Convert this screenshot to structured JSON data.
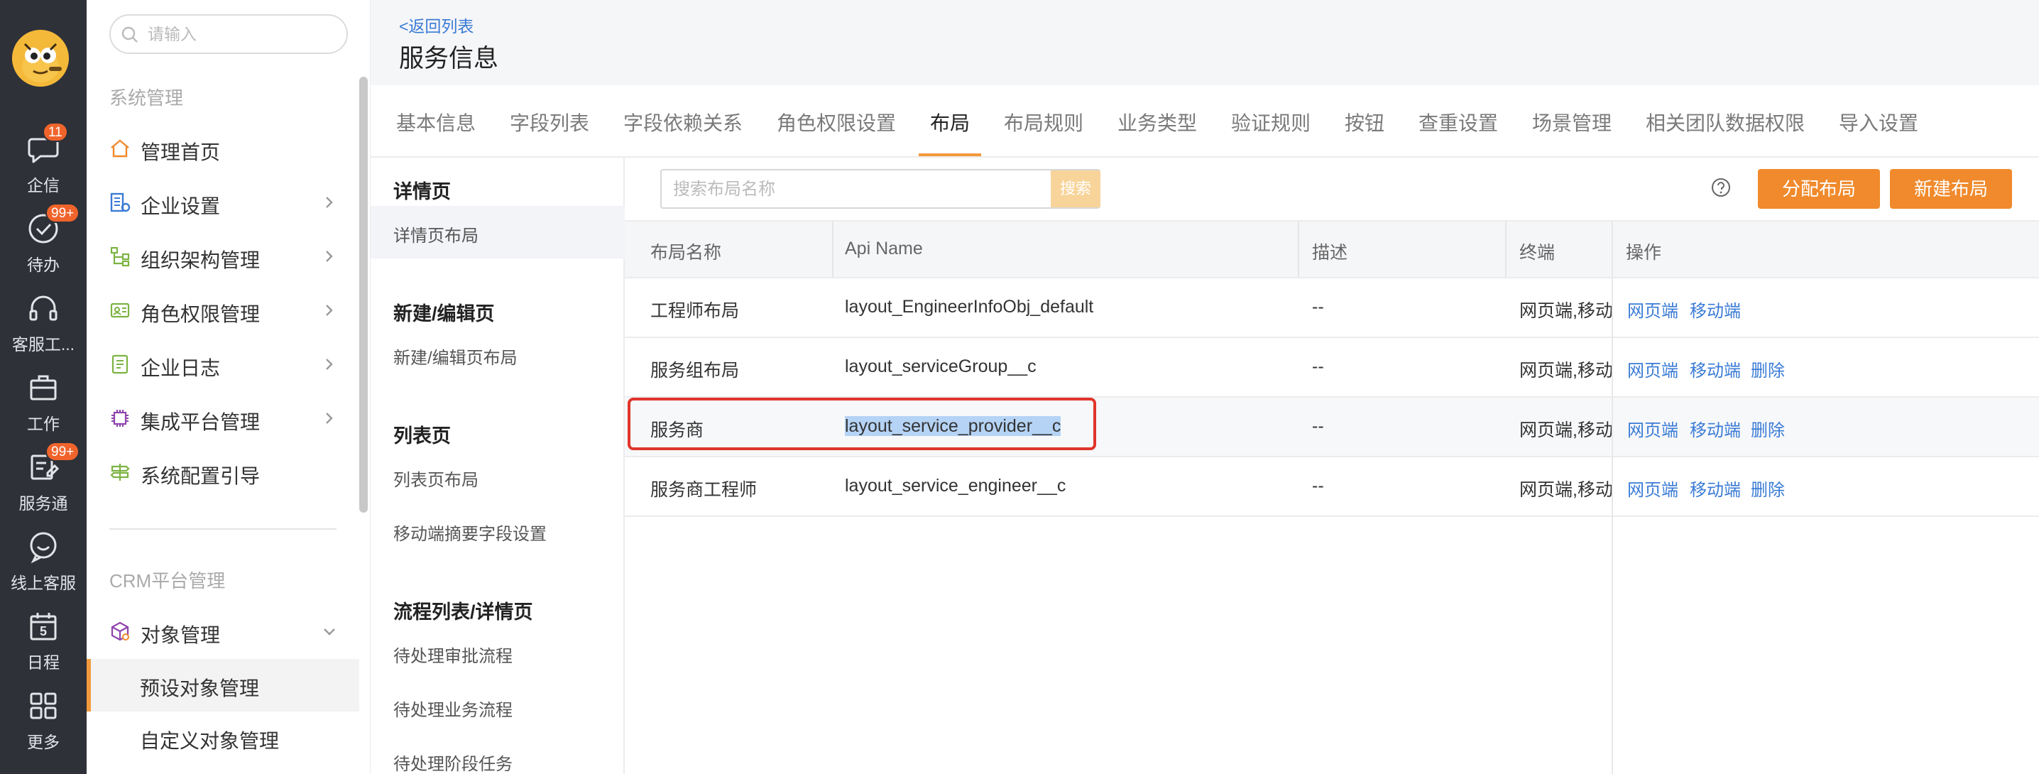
{
  "rail": {
    "items": [
      {
        "icon": "chat-icon",
        "label": "企信",
        "badge": "11"
      },
      {
        "icon": "check-circle-icon",
        "label": "待办",
        "badge": "99+"
      },
      {
        "icon": "headset-icon",
        "label": "客服工..."
      },
      {
        "icon": "briefcase-icon",
        "label": "工作"
      },
      {
        "icon": "service-icon",
        "label": "服务通",
        "badge": "99+"
      },
      {
        "icon": "online-service-icon",
        "label": "线上客服"
      },
      {
        "icon": "calendar-icon",
        "label": "日程",
        "day": "5"
      },
      {
        "icon": "grid-icon",
        "label": "更多"
      }
    ]
  },
  "menu": {
    "search_placeholder": "请输入",
    "section_system": "系统管理",
    "items": [
      {
        "icon": "home-icon",
        "label": "管理首页",
        "color": "#f08a2c"
      },
      {
        "icon": "building-icon",
        "label": "企业设置",
        "color": "#3a7bd5"
      },
      {
        "icon": "org-tree-icon",
        "label": "组织架构管理",
        "color": "#7cb342"
      },
      {
        "icon": "id-card-icon",
        "label": "角色权限管理",
        "color": "#7cb342"
      },
      {
        "icon": "log-icon",
        "label": "企业日志",
        "color": "#7cb342"
      },
      {
        "icon": "chip-icon",
        "label": "集成平台管理",
        "color": "#8e44ad"
      },
      {
        "icon": "signpost-icon",
        "label": "系统配置引导",
        "color": "#7cb342"
      }
    ],
    "section_crm": "CRM平台管理",
    "object_mgmt": {
      "icon": "cube-icon",
      "label": "对象管理",
      "color": "#8e44ad"
    },
    "sub_items": [
      "预设对象管理",
      "自定义对象管理"
    ]
  },
  "header": {
    "back": "<返回列表",
    "title": "服务信息"
  },
  "tabs": [
    "基本信息",
    "字段列表",
    "字段依赖关系",
    "角色权限设置",
    "布局",
    "布局规则",
    "业务类型",
    "验证规则",
    "按钮",
    "查重设置",
    "场景管理",
    "相关团队数据权限",
    "导入设置"
  ],
  "active_tab": "布局",
  "subnav": {
    "groups": [
      {
        "title": "详情页",
        "items": [
          "详情页布局"
        ]
      },
      {
        "title": "新建/编辑页",
        "items": [
          "新建/编辑页布局"
        ]
      },
      {
        "title": "列表页",
        "items": [
          "列表页布局",
          "移动端摘要字段设置"
        ]
      },
      {
        "title": "流程列表/详情页",
        "items": [
          "待处理审批流程",
          "待处理业务流程",
          "待处理阶段任务"
        ]
      }
    ]
  },
  "content": {
    "search_placeholder": "搜索布局名称",
    "search_button": "搜索",
    "assign_button": "分配布局",
    "new_button": "新建布局",
    "columns": [
      "布局名称",
      "Api Name",
      "描述",
      "终端",
      "操作"
    ],
    "rows": [
      {
        "name": "工程师布局",
        "api": "layout_EngineerInfoObj_default",
        "desc": "--",
        "terminal": "网页端,移动端",
        "actions": [
          "网页端",
          "移动端"
        ]
      },
      {
        "name": "服务组布局",
        "api": "layout_serviceGroup__c",
        "desc": "--",
        "terminal": "网页端,移动端",
        "actions": [
          "网页端",
          "移动端",
          "删除"
        ]
      },
      {
        "name": "服务商",
        "api": "layout_service_provider__c",
        "desc": "--",
        "terminal": "网页端,移动端",
        "actions": [
          "网页端",
          "移动端",
          "删除"
        ]
      },
      {
        "name": "服务商工程师",
        "api": "layout_service_engineer__c",
        "desc": "--",
        "terminal": "网页端,移动端",
        "actions": [
          "网页端",
          "移动端",
          "删除"
        ]
      }
    ]
  },
  "colors": {
    "accent": "#f08a2c",
    "link": "#3a7bd5",
    "rail_bg": "#2e3138",
    "highlight": "#e0352b"
  }
}
